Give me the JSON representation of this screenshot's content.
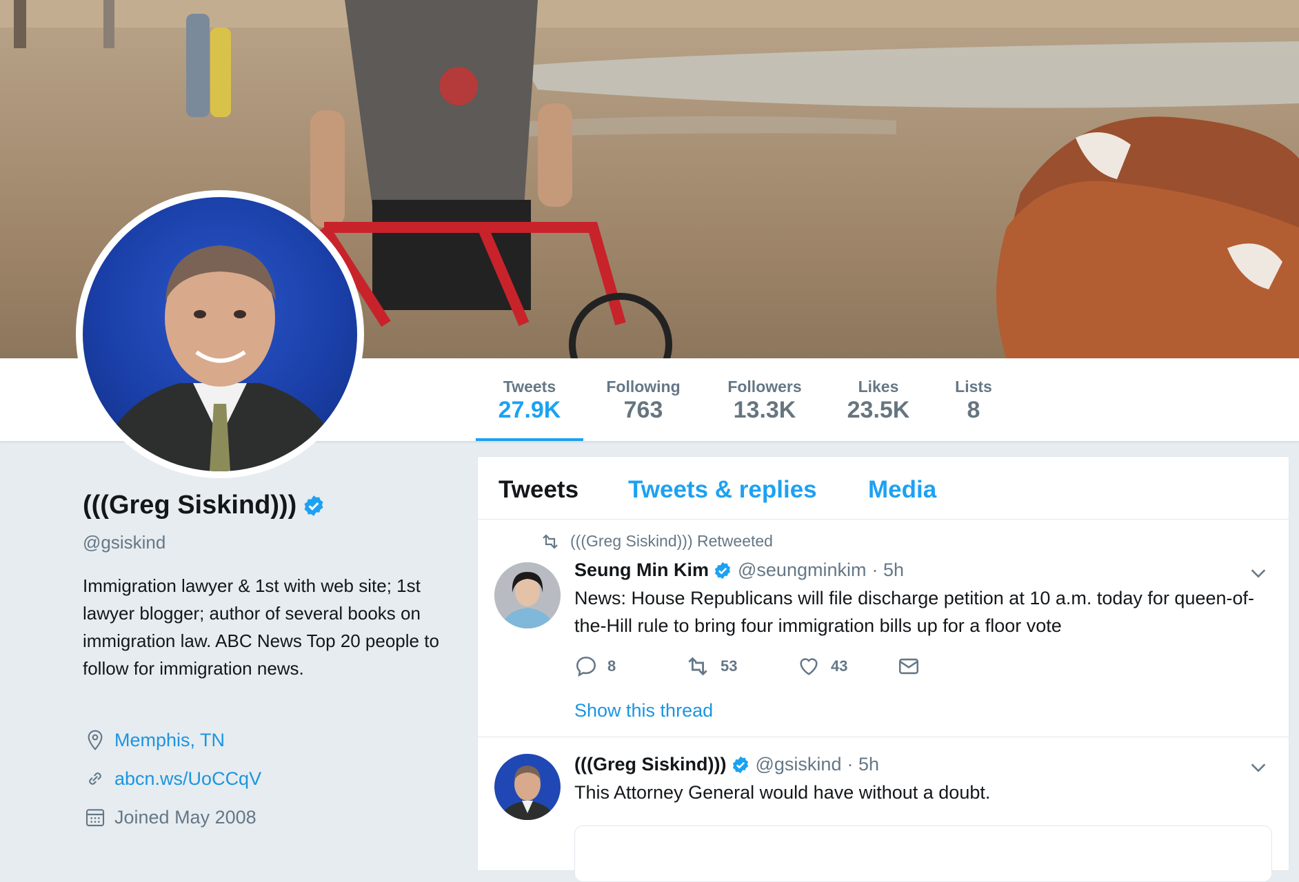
{
  "profile": {
    "name": "(((Greg Siskind)))",
    "handle": "@gsiskind",
    "bio": "Immigration lawyer & 1st with web site; 1st lawyer blogger; author of several books on immigration law. ABC News Top 20 people to follow for immigration news.",
    "location": "Memphis, TN",
    "website": "abcn.ws/UoCCqV",
    "joined": "Joined May 2008",
    "verified": true
  },
  "stats": [
    {
      "label": "Tweets",
      "value": "27.9K",
      "active": true
    },
    {
      "label": "Following",
      "value": "763",
      "active": false
    },
    {
      "label": "Followers",
      "value": "13.3K",
      "active": false
    },
    {
      "label": "Likes",
      "value": "23.5K",
      "active": false
    },
    {
      "label": "Lists",
      "value": "8",
      "active": false
    }
  ],
  "tabs": [
    {
      "label": "Tweets",
      "active": true
    },
    {
      "label": "Tweets & replies",
      "active": false
    },
    {
      "label": "Media",
      "active": false
    }
  ],
  "tweets": [
    {
      "retweet_context": "(((Greg Siskind))) Retweeted",
      "author_name": "Seung Min Kim",
      "author_handle": "@seungminkim",
      "time": "· 5h",
      "text": "News: House Republicans will file discharge petition at 10 a.m. today for queen-of-the-Hill rule to bring four immigration bills up for a floor vote",
      "replies": "8",
      "retweets": "53",
      "likes": "43",
      "show_thread": "Show this thread"
    },
    {
      "author_name": "(((Greg Siskind)))",
      "author_handle": "@gsiskind",
      "time": "· 5h",
      "text": "This Attorney General would have without a doubt."
    }
  ],
  "colors": {
    "accent": "#1da1f2",
    "link": "#1b95e0",
    "muted": "#657786",
    "background": "#e6ecf0"
  },
  "icons": [
    "retweet-icon",
    "verified-icon",
    "chevron-down-icon",
    "reply-icon",
    "like-icon",
    "message-icon",
    "location-icon",
    "link-icon",
    "calendar-icon"
  ]
}
